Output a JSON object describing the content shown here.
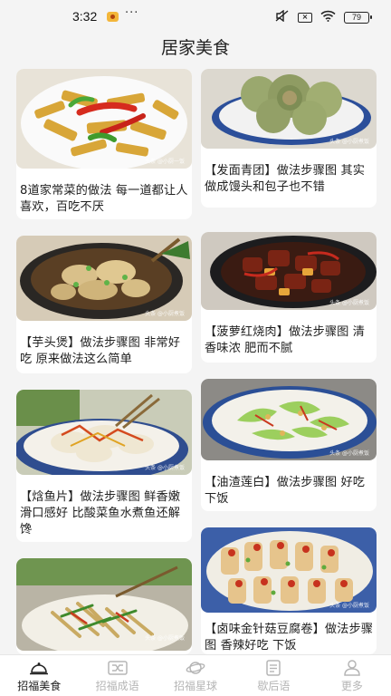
{
  "status_bar": {
    "time": "3:32",
    "dots": "···",
    "battery": "79"
  },
  "header": {
    "title": "居家美食"
  },
  "recipes": [
    {
      "title": "8道家常菜的做法 每一道都让人喜欢，百吃不厌",
      "watermark": "头条 @小厨一饭"
    },
    {
      "title": "【发面青团】做法步骤图 其实做成馒头和包子也不错",
      "watermark": "头条 @小厨煮饭"
    },
    {
      "title": "【芋头煲】做法步骤图 非常好吃 原来做法这么简单",
      "watermark": "头条 @小厨煮饭"
    },
    {
      "title": "【菠萝红烧肉】做法步骤图 清香味浓 肥而不腻",
      "watermark": "头条 @小厨煮饭"
    },
    {
      "title": "【焓鱼片】做法步骤图 鲜香嫩滑口感好 比酸菜鱼水煮鱼还解馋",
      "watermark": "头条 @小厨煮饭"
    },
    {
      "title": "【油渣莲白】做法步骤图 好吃下饭",
      "watermark": "头条 @小厨煮饭"
    },
    {
      "title": "",
      "watermark": "头条 @小厨煮饭"
    },
    {
      "title": "【卤味金针菇豆腐卷】做法步骤图 香辣好吃 下饭",
      "watermark": "头条 @小厨煮饭"
    }
  ],
  "tabs": [
    {
      "label": "招福美食",
      "icon": "cloche-icon",
      "active": true
    },
    {
      "label": "招福成语",
      "icon": "shuffle-icon",
      "active": false
    },
    {
      "label": "招福星球",
      "icon": "planet-icon",
      "active": false
    },
    {
      "label": "歇后语",
      "icon": "document-icon",
      "active": false
    },
    {
      "label": "更多",
      "icon": "person-icon",
      "active": false
    }
  ],
  "colors": {
    "active_tab": "#222222",
    "inactive_tab": "#b5b5b5",
    "background": "#f4f4f4"
  }
}
